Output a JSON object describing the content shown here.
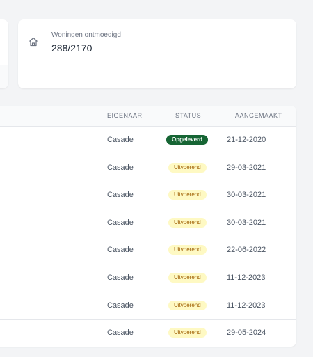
{
  "stat": {
    "icon": "home-icon",
    "label": "Woningen ontmoedigd",
    "value": "288/2170"
  },
  "table": {
    "headers": {
      "owner": "EIGENAAR",
      "status": "STATUS",
      "created": "AANGEMAAKT"
    },
    "rows": [
      {
        "owner": "Casade",
        "status": "Opgeleverd",
        "status_type": "done",
        "created": "21-12-2020"
      },
      {
        "owner": "Casade",
        "status": "Uitvoerend",
        "status_type": "busy",
        "created": "29-03-2021"
      },
      {
        "owner": "Casade",
        "status": "Uitvoerend",
        "status_type": "busy",
        "created": "30-03-2021"
      },
      {
        "owner": "Casade",
        "status": "Uitvoerend",
        "status_type": "busy",
        "created": "30-03-2021"
      },
      {
        "owner": "Casade",
        "status": "Uitvoerend",
        "status_type": "busy",
        "created": "22-06-2022"
      },
      {
        "owner": "Casade",
        "status": "Uitvoerend",
        "status_type": "busy",
        "created": "11-12-2023"
      },
      {
        "owner": "Casade",
        "status": "Uitvoerend",
        "status_type": "busy",
        "created": "11-12-2023"
      },
      {
        "owner": "Casade",
        "status": "Uitvoerend",
        "status_type": "busy",
        "created": "29-05-2024"
      }
    ]
  },
  "colors": {
    "done_badge_bg": "#166534",
    "busy_badge_bg": "#fef9c3",
    "busy_badge_text": "#a16207"
  }
}
